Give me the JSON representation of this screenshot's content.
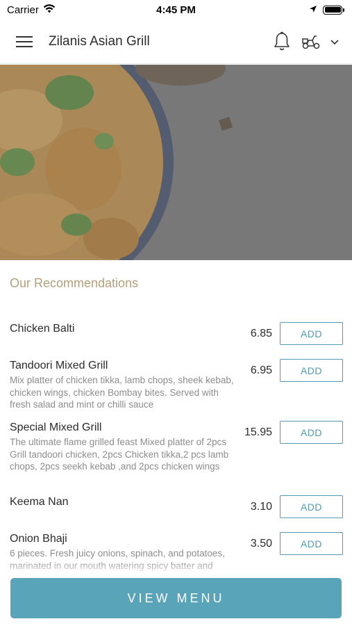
{
  "status_bar": {
    "carrier": "Carrier",
    "time": "4:45 PM"
  },
  "header": {
    "title": "Zilanis Asian Grill"
  },
  "hero": {
    "image": "curry-dish-photo"
  },
  "recommendations": {
    "title": "Our Recommendations",
    "add_label": "ADD",
    "items": [
      {
        "name": "Chicken Balti",
        "price": "6.85",
        "desc": ""
      },
      {
        "name": "Tandoori Mixed Grill",
        "price": "6.95",
        "desc": "Mix platter of chicken tikka, lamb chops, sheek kebab, chicken wings, chicken Bombay bites. Served with fresh salad and mint or chilli sauce"
      },
      {
        "name": "Special Mixed Grill",
        "price": "15.95",
        "desc": "The ultimate flame grilled feast Mixed platter of 2pcs Grill tandoori chicken, 2pcs Chicken tikka,2 pcs lamb chops, 2pcs seekh kebab ,and 2pcs chicken wings"
      },
      {
        "name": "Keema Nan",
        "price": "3.10",
        "desc": ""
      },
      {
        "name": "Onion Bhaji",
        "price": "3.50",
        "desc": "6 pieces. Fresh juicy onions, spinach, and potatoes, marinated in our mouth watering spicy batter and"
      }
    ]
  },
  "footer": {
    "view_menu_label": "VIEW MENU"
  },
  "colors": {
    "accent": "#5aa4ba",
    "section_title": "#b3a07a"
  }
}
